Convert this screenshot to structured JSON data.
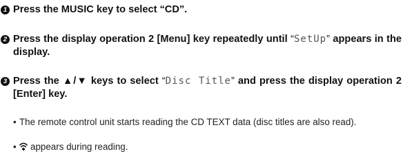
{
  "steps": [
    {
      "number": "1",
      "text_before": "Press the MUSIC key to select “CD”.",
      "display_text": "",
      "text_after": ""
    },
    {
      "number": "2",
      "text_before": "Press the display operation 2 [Menu] key repeatedly until ",
      "open_quote": "“",
      "display_text": "SetUp",
      "close_quote": "”",
      "text_after": " appears in the display."
    },
    {
      "number": "3",
      "text_before": "Press the ▲/▼ keys to select ",
      "open_quote": "“",
      "display_text": "Disc Title",
      "close_quote": "”",
      "text_after": " and press the display operation 2 [Enter] key."
    }
  ],
  "bullets": [
    {
      "dot": "•",
      "text": "The remote  control unit starts reading the CD TEXT data (disc titles are also read)."
    },
    {
      "dot": "•",
      "icon": "reception-icon",
      "text": "appears during reading."
    }
  ]
}
